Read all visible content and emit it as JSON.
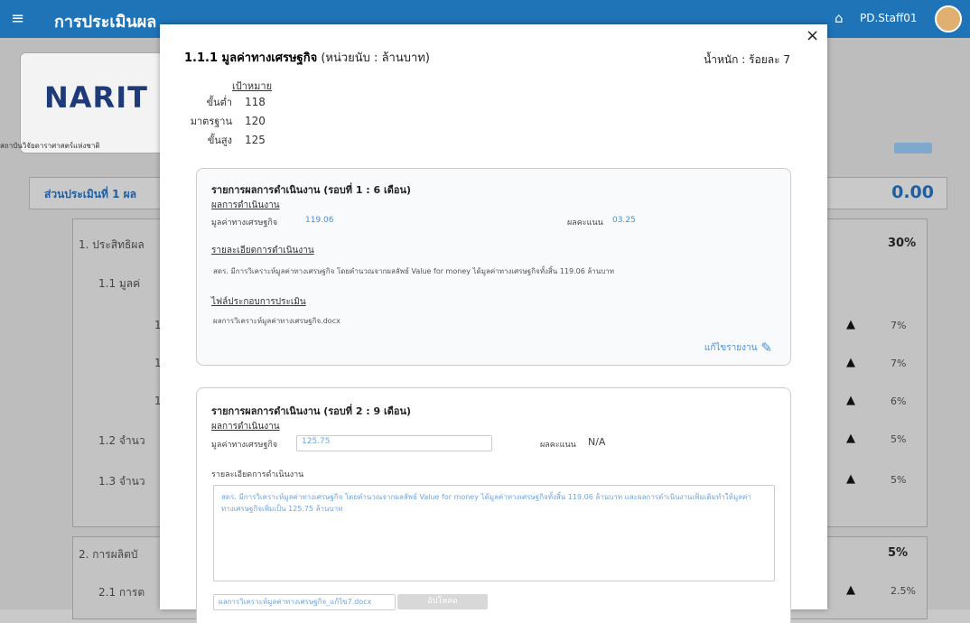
{
  "app": {
    "title": "การประเมินผล",
    "user": "PD.Staff01",
    "logo_text": "NARIT",
    "org_name": "สถาบันวิจัยดาราศาสตร์แห่งชาติ"
  },
  "background": {
    "section_title": "ส่วนประเมินที่ 1 ผล",
    "section_score": "0.00",
    "rows": [
      {
        "label": "1. ประสิทธิผล",
        "value": "30%"
      },
      {
        "label": "1.1 มูลค่",
        "value": ""
      },
      {
        "label": "1",
        "value": "7%"
      },
      {
        "label": "1",
        "value": "7%"
      },
      {
        "label": "1",
        "value": "6%"
      },
      {
        "label": "1.2 จำนว",
        "value": "5%"
      },
      {
        "label": "1.3 จำนว",
        "value": "5%"
      },
      {
        "label": "2. การผลิตบั",
        "value": "5%"
      },
      {
        "label": "2.1 การต",
        "value": "2.5%"
      }
    ]
  },
  "modal": {
    "title_bold": "1.1.1 มูลค่าทางเศรษฐกิจ",
    "title_unit": "(หน่วยนับ : ล้านบาท)",
    "weight": "น้ำหนัก : ร้อยละ 7",
    "close_icon": "×",
    "target_header": "เป้าหมาย",
    "targets": [
      {
        "label": "ขั้นต่ำ",
        "value": "118"
      },
      {
        "label": "มาตรฐาน",
        "value": "120"
      },
      {
        "label": "ขั้นสูง",
        "value": "125"
      }
    ],
    "round1": {
      "title": "รายการผลการดำเนินงาน (รอบที่ 1 : 6 เดือน)",
      "result_header": "ผลการดำเนินงาน",
      "field_label": "มูลค่าทางเศรษฐกิจ",
      "field_value": "119.06",
      "score_label": "ผลคะแนน",
      "score_value": "03.25",
      "detail_header": "รายละเอียดการดำเนินงาน",
      "detail_text": "สดร. มีการวิเคราะห์มูลค่าทางเศรษฐกิจ โดยคำนวณจากผลลัพธ์ Value for money ได้มูลค่าทางเศรษฐกิจทั้งสิ้น 119.06 ล้านบาท",
      "file_header": "ไฟล์ประกอบการประเมิน",
      "file_name": "ผลการวิเคราะห์มูลค่าทางเศรษฐกิจ.docx",
      "edit_label": "แก้ไขรายงาน"
    },
    "round2": {
      "title": "รายการผลการดำเนินงาน (รอบที่ 2 : 9 เดือน)",
      "result_header": "ผลการดำเนินงาน",
      "field_label": "มูลค่าทางเศรษฐกิจ",
      "field_value": "125.75",
      "score_label": "ผลคะแนน",
      "score_value": "N/A",
      "detail_header": "รายละเอียดการดำเนินงาน",
      "detail_text": "สดร. มีการวิเคราะห์มูลค่าทางเศรษฐกิจ โดยคำนวณจากผลลัพธ์ Value for money ได้มูลค่าทางเศรษฐกิจทั้งสิ้น 119.06 ล้านบาท และผลการดำเนินงานเพิ่มเติมทำให้มูลค่าทางเศรษฐกิจเพิ่มเป็น 125.75 ล้านบาท",
      "file_name": "ผลการวิเคราะห์มูลค่าทางเศรษฐกิจ_แก้ไข7.docx",
      "upload_label": "อัปโหลด"
    }
  }
}
